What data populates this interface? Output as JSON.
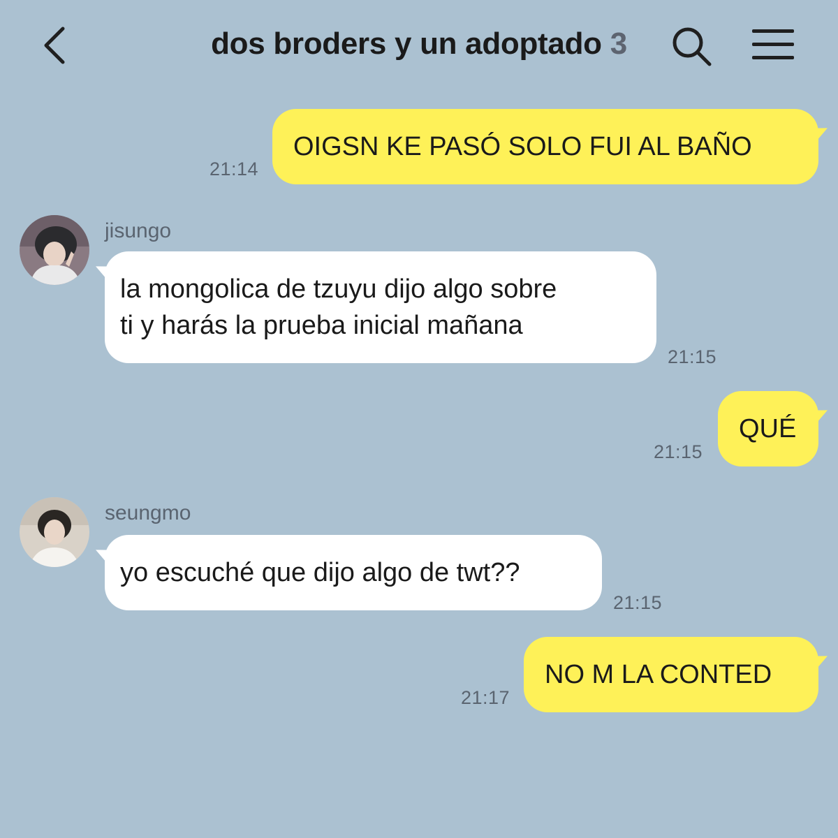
{
  "header": {
    "title": "dos broders y un adoptado",
    "member_count": "3",
    "back_icon": "chevron-left-icon",
    "search_icon": "search-icon",
    "menu_icon": "hamburger-menu-icon"
  },
  "colors": {
    "background": "#abc1d1",
    "my_bubble": "#fef158",
    "their_bubble": "#ffffff"
  },
  "messages": [
    {
      "from": "me",
      "text": "OIGSN KE PASÓ SOLO FUI AL BAÑO",
      "time": "21:14"
    },
    {
      "from": "jisungo",
      "sender": "jisungo",
      "lines": [
        "la mongolica de tzuyu dijo algo sobre",
        "ti y harás la prueba inicial mañana"
      ],
      "time": "21:15"
    },
    {
      "from": "me",
      "text": "QUÉ",
      "time": "21:15"
    },
    {
      "from": "seungmo",
      "sender": "seungmo",
      "text": "yo escuché que dijo algo de twt??",
      "time": "21:15"
    },
    {
      "from": "me",
      "text": "NO M LA CONTED",
      "time": "21:17"
    }
  ]
}
